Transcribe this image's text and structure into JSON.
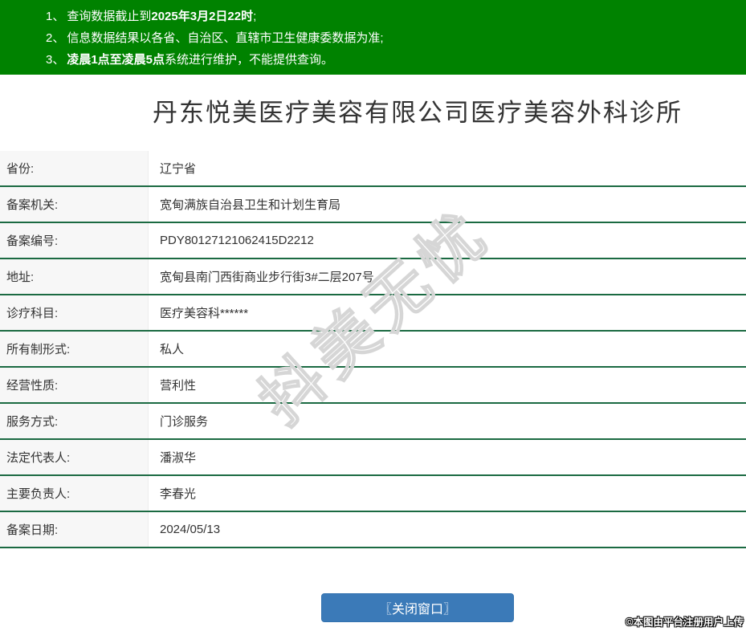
{
  "header": {
    "bg_color": "#008200",
    "notices": [
      {
        "num": "1、",
        "pre": "查询数据截止到",
        "bold": "2025年3月2日22时",
        "post": ";"
      },
      {
        "num": "2、",
        "pre": "信息数据结果以各省、自治区、直辖市卫生健康委数据为准;",
        "bold": "",
        "post": ""
      },
      {
        "num": "3、",
        "pre": "",
        "bold": "凌晨1点至凌晨5点",
        "post": "系统进行维护，不能提供查询。"
      }
    ]
  },
  "title": "丹东悦美医疗美容有限公司医疗美容外科诊所",
  "table": {
    "border_color": "#1b6a42",
    "label_bg": "#f7f7f7",
    "rows": [
      {
        "label": "省份:",
        "value": "辽宁省"
      },
      {
        "label": "备案机关:",
        "value": "宽甸满族自治县卫生和计划生育局"
      },
      {
        "label": "备案编号:",
        "value": "PDY80127121062415D2212"
      },
      {
        "label": "地址:",
        "value": "宽甸县南门西街商业步行街3#二层207号"
      },
      {
        "label": "诊疗科目:",
        "value": "医疗美容科******"
      },
      {
        "label": "所有制形式:",
        "value": "私人"
      },
      {
        "label": "经营性质:",
        "value": "营利性"
      },
      {
        "label": "服务方式:",
        "value": "门诊服务"
      },
      {
        "label": "法定代表人:",
        "value": "潘淑华"
      },
      {
        "label": "主要负责人:",
        "value": "李春光"
      },
      {
        "label": "备案日期:",
        "value": "2024/05/13"
      }
    ]
  },
  "watermark_text": "抖美无忧",
  "footer": {
    "close_button_label": "〖关闭窗口〗",
    "button_color": "#3b7ab8",
    "copyright": "©本图由平台注册用户上传"
  }
}
